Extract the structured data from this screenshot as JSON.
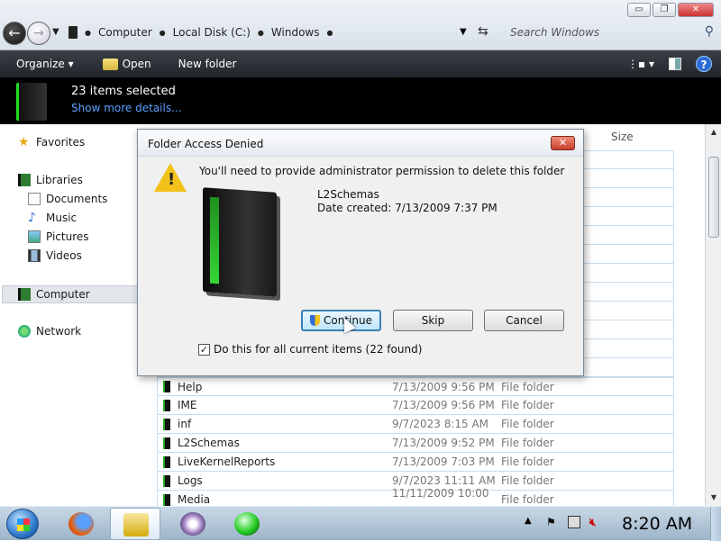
{
  "window": {
    "minimize_label": "▭",
    "restore_label": "❐",
    "close_label": "✕"
  },
  "address": {
    "crumbs": [
      "Computer",
      "Local Disk (C:)",
      "Windows"
    ],
    "search_placeholder": "Search Windows"
  },
  "toolbar": {
    "organize_label": "Organize ▾",
    "open_label": "Open",
    "new_folder_label": "New folder",
    "help_label": "?"
  },
  "details": {
    "count_text": "23 items selected",
    "more_link": "Show more details..."
  },
  "nav": {
    "favorites": "Favorites",
    "libraries": "Libraries",
    "documents": "Documents",
    "music": "Music",
    "pictures": "Pictures",
    "videos": "Videos",
    "computer": "Computer",
    "network": "Network"
  },
  "filelist": {
    "size_header": "Size",
    "rows": [
      {
        "name": "Help",
        "date": "7/13/2009 9:56 PM",
        "type": "File folder"
      },
      {
        "name": "IME",
        "date": "7/13/2009 9:56 PM",
        "type": "File folder"
      },
      {
        "name": "inf",
        "date": "9/7/2023 8:15 AM",
        "type": "File folder"
      },
      {
        "name": "L2Schemas",
        "date": "7/13/2009 9:52 PM",
        "type": "File folder"
      },
      {
        "name": "LiveKernelReports",
        "date": "7/13/2009 7:03 PM",
        "type": "File folder"
      },
      {
        "name": "Logs",
        "date": "9/7/2023 11:11 AM",
        "type": "File folder"
      },
      {
        "name": "Media",
        "date": "11/11/2009 10:00 ...",
        "type": "File folder"
      }
    ]
  },
  "dialog": {
    "title": "Folder Access Denied",
    "close_label": "✕",
    "message": "You'll need to provide administrator permission to delete this folder",
    "folder_name": "L2Schemas",
    "date_created": "Date created: 7/13/2009 7:37 PM",
    "continue_label": "Continue",
    "skip_label": "Skip",
    "cancel_label": "Cancel",
    "checkbox_label": "Do this for all current items (22 found)",
    "checkbox_checked": true
  },
  "taskbar": {
    "clock": "8:20 AM"
  },
  "colors": {
    "accent_green": "#35d635",
    "toolbar_bg": "#2b2f35",
    "link_blue": "#5aa0ff"
  }
}
